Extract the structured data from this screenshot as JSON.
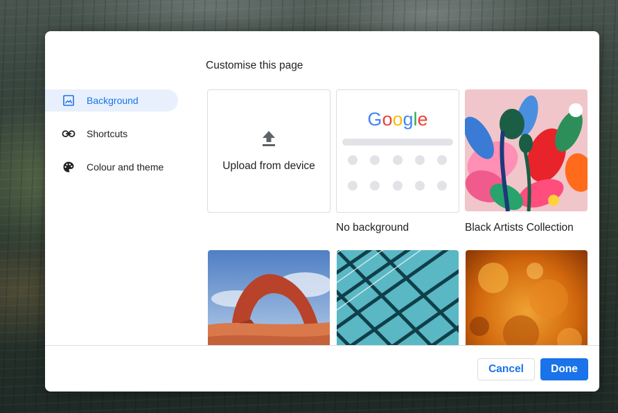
{
  "dialog": {
    "title": "Customise this page"
  },
  "sidebar": {
    "items": [
      {
        "label": "Background",
        "icon": "image-icon",
        "active": true
      },
      {
        "label": "Shortcuts",
        "icon": "link-icon",
        "active": false
      },
      {
        "label": "Colour and theme",
        "icon": "palette-icon",
        "active": false
      }
    ]
  },
  "backgrounds": {
    "upload_label": "Upload from device",
    "no_background_label": "No background",
    "black_artists_label": "Black Artists Collection",
    "google_letters": [
      "G",
      "o",
      "o",
      "g",
      "l",
      "e"
    ],
    "google_colors": [
      "#4285f4",
      "#ea4335",
      "#fbbc05",
      "#4285f4",
      "#34a853",
      "#ea4335"
    ]
  },
  "footer": {
    "cancel_label": "Cancel",
    "done_label": "Done"
  },
  "colors": {
    "accent": "#1a73e8",
    "active_nav_bg": "#e8f0fe"
  }
}
